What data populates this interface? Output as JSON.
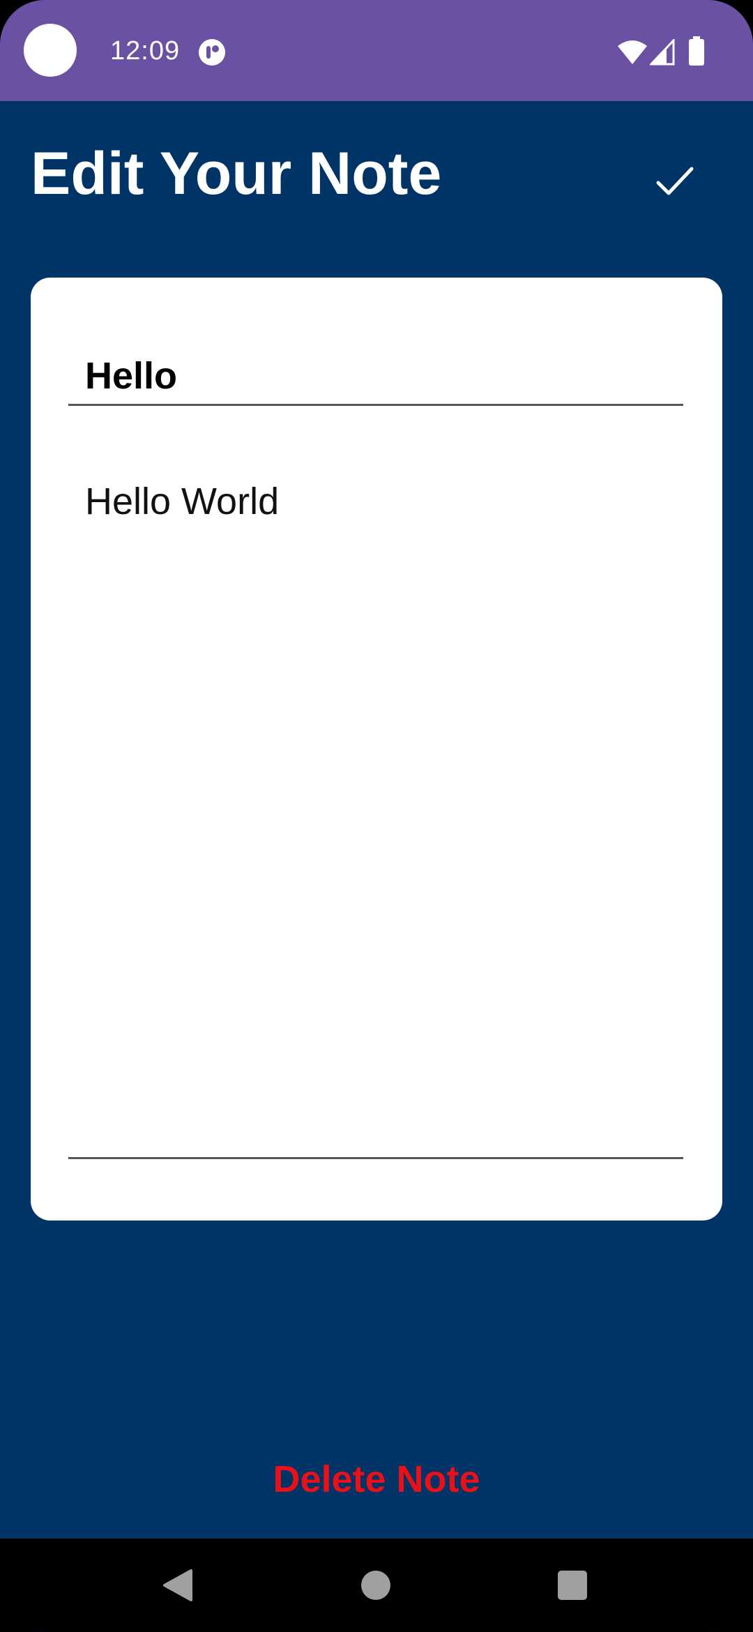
{
  "status_bar": {
    "time": "12:09",
    "icons": [
      "camera-dot",
      "app-notification-icon",
      "wifi-icon",
      "signal-icon",
      "battery-icon"
    ],
    "background": "#6A51A3"
  },
  "header": {
    "title": "Edit Your Note",
    "save_icon": "checkmark-icon"
  },
  "note": {
    "title_value": "Hello",
    "body_value": "Hello World"
  },
  "actions": {
    "delete_label": "Delete Note",
    "delete_color": "#E8111A"
  },
  "nav_bar": {
    "icons": [
      "back-icon",
      "home-icon",
      "recents-icon"
    ]
  },
  "colors": {
    "page_background": "#003366",
    "card_background": "#FFFFFF",
    "status_bar": "#6A51A3"
  }
}
